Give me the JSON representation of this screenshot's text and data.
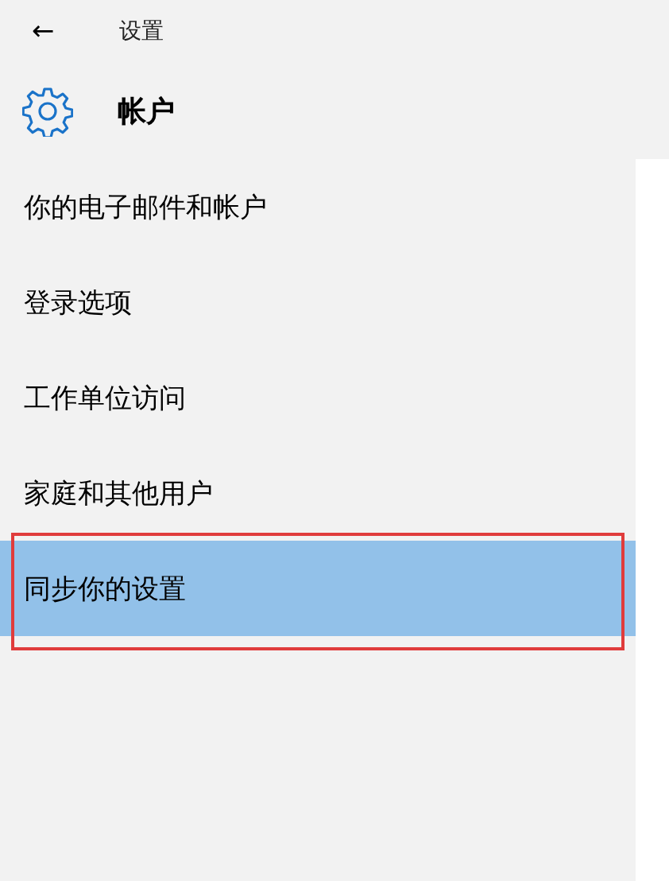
{
  "header": {
    "back": "←",
    "title": "设置"
  },
  "section": {
    "title": "帐户"
  },
  "sidebar": {
    "items": [
      {
        "label": "你的电子邮件和帐户",
        "selected": false
      },
      {
        "label": "登录选项",
        "selected": false
      },
      {
        "label": "工作单位访问",
        "selected": false
      },
      {
        "label": "家庭和其他用户",
        "selected": false
      },
      {
        "label": "同步你的设置",
        "selected": true
      }
    ]
  }
}
